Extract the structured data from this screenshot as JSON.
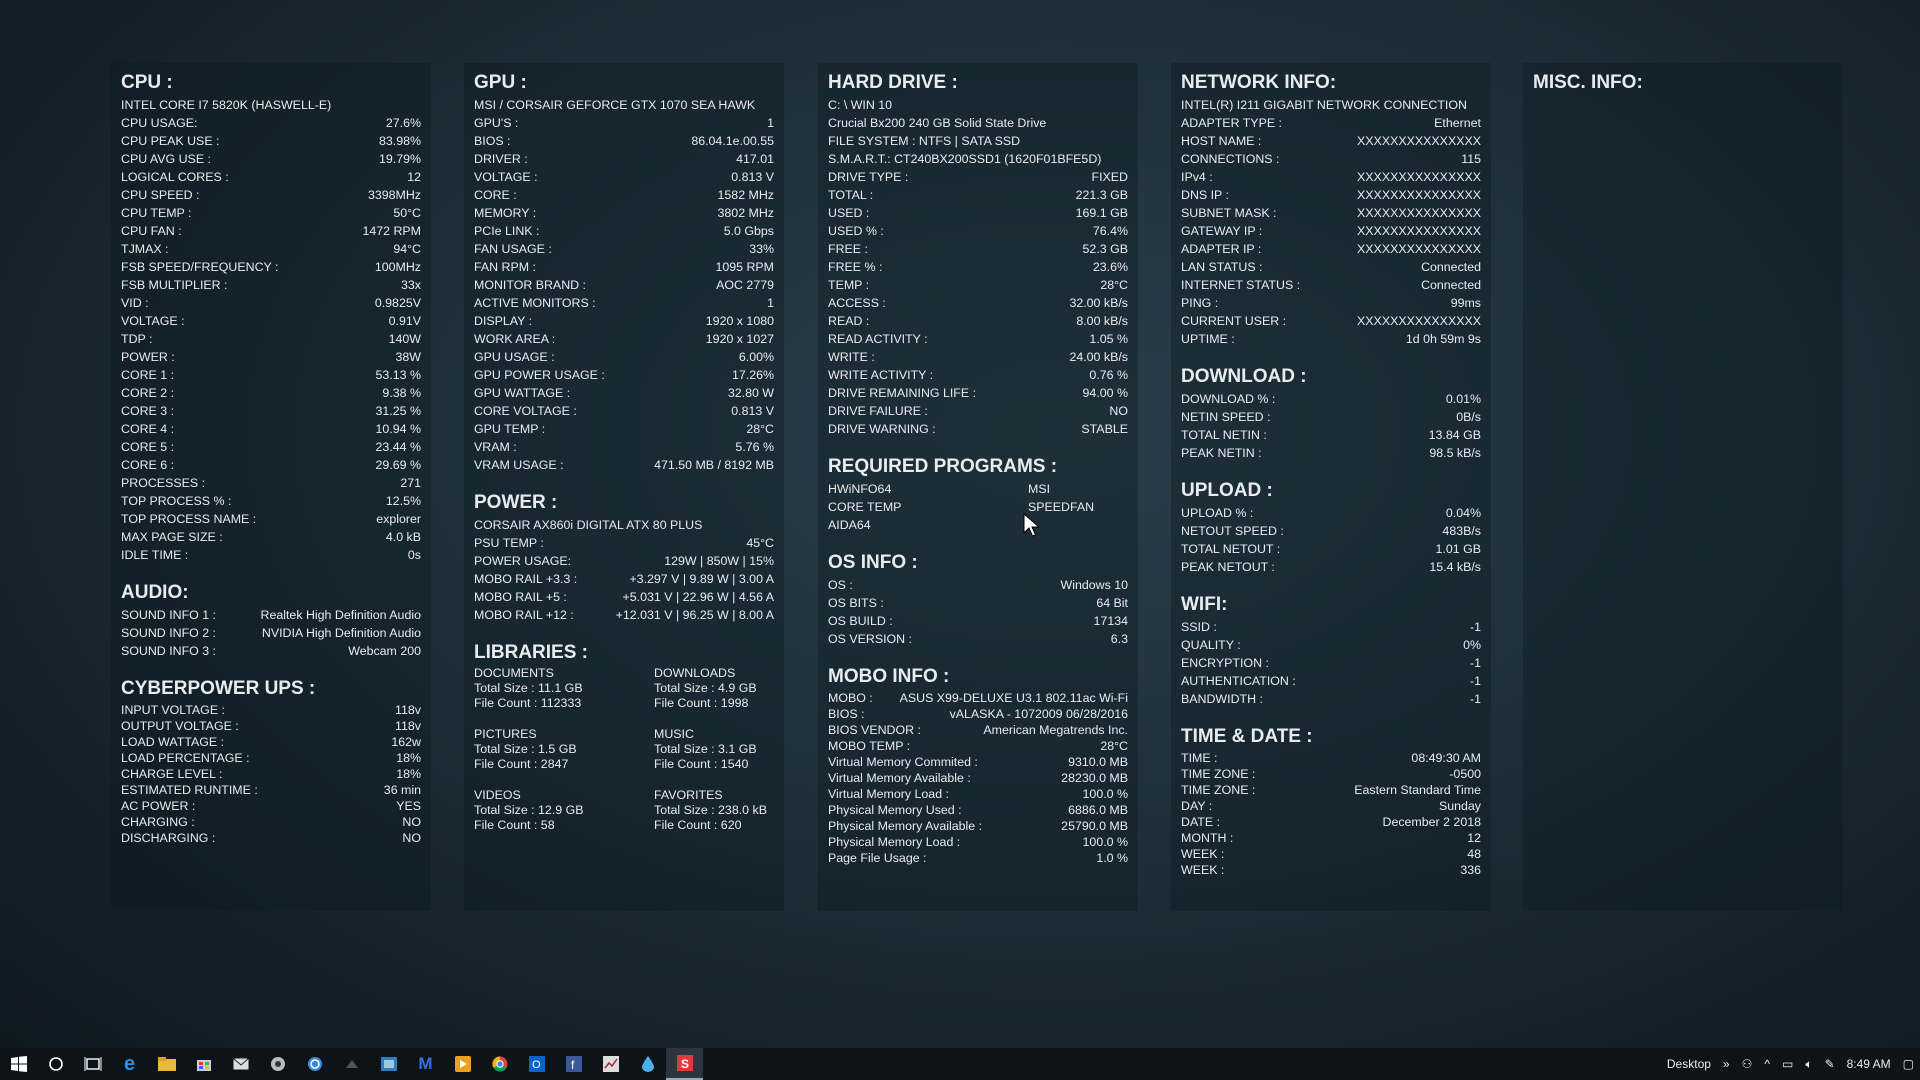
{
  "cpu": {
    "title": "CPU :",
    "model": "INTEL CORE I7 5820K (HASWELL-E)",
    "rows": [
      [
        "CPU USAGE:",
        "27.6%"
      ],
      [
        "CPU PEAK USE :",
        "83.98%"
      ],
      [
        "CPU AVG USE :",
        "19.79%"
      ],
      [
        "LOGICAL CORES :",
        "12"
      ],
      [
        "CPU SPEED :",
        "3398MHz"
      ],
      [
        "CPU TEMP :",
        "50°C"
      ],
      [
        "CPU FAN :",
        "1472 RPM"
      ],
      [
        "TJMAX :",
        "94°C"
      ],
      [
        "FSB SPEED/FREQUENCY :",
        "100MHz"
      ],
      [
        "FSB MULTIPLIER :",
        "33x"
      ],
      [
        "VID :",
        "0.9825V"
      ],
      [
        "VOLTAGE :",
        "0.91V"
      ],
      [
        "TDP :",
        "140W"
      ],
      [
        "POWER :",
        "38W"
      ],
      [
        "CORE 1 :",
        "53.13 %"
      ],
      [
        "CORE 2 :",
        "9.38 %"
      ],
      [
        "CORE 3 :",
        "31.25 %"
      ],
      [
        "CORE 4 :",
        "10.94 %"
      ],
      [
        "CORE 5 :",
        "23.44 %"
      ],
      [
        "CORE 6 :",
        "29.69 %"
      ],
      [
        "PROCESSES :",
        "271"
      ],
      [
        "TOP PROCESS % :",
        "12.5%"
      ],
      [
        "TOP PROCESS NAME :",
        "explorer"
      ],
      [
        "MAX PAGE SIZE :",
        "4.0 kB"
      ],
      [
        "IDLE TIME :",
        "0s"
      ]
    ]
  },
  "audio": {
    "title": "AUDIO:",
    "rows": [
      [
        "SOUND INFO 1 :",
        "Realtek High Definition Audio"
      ],
      [
        "SOUND INFO 2 :",
        "NVIDIA High Definition Audio"
      ],
      [
        "SOUND INFO 3 :",
        "Webcam 200"
      ]
    ]
  },
  "ups": {
    "title": "CYBERPOWER UPS :",
    "rows": [
      [
        "INPUT VOLTAGE :",
        "118v"
      ],
      [
        "OUTPUT VOLTAGE :",
        "118v"
      ],
      [
        "LOAD WATTAGE :",
        "162w"
      ],
      [
        "LOAD PERCENTAGE :",
        "18%"
      ],
      [
        "CHARGE LEVEL :",
        "18%"
      ],
      [
        "ESTIMATED RUNTIME :",
        "36 min"
      ],
      [
        "AC POWER :",
        "YES"
      ],
      [
        "CHARGING :",
        "NO"
      ],
      [
        "DISCHARGING :",
        "NO"
      ]
    ]
  },
  "gpu": {
    "title": "GPU :",
    "model": "MSI / CORSAIR  GEFORCE GTX 1070 SEA HAWK",
    "rows": [
      [
        "GPU'S :",
        "1"
      ],
      [
        "BIOS :",
        "86.04.1e.00.55"
      ],
      [
        "DRIVER :",
        "417.01"
      ],
      [
        "VOLTAGE :",
        "0.813 V"
      ],
      [
        "CORE :",
        "1582 MHz"
      ],
      [
        "MEMORY :",
        "3802 MHz"
      ],
      [
        "PCIe LINK :",
        "5.0 Gbps"
      ],
      [
        "FAN USAGE :",
        "33%"
      ],
      [
        "FAN RPM :",
        "1095 RPM"
      ],
      [
        "MONITOR BRAND :",
        "AOC 2779"
      ],
      [
        "ACTIVE MONITORS :",
        "1"
      ],
      [
        "DISPLAY :",
        "1920 x 1080"
      ],
      [
        "WORK AREA :",
        "1920 x 1027"
      ],
      [
        "GPU USAGE :",
        "6.00%"
      ],
      [
        "GPU POWER USAGE :",
        "17.26%"
      ],
      [
        "GPU WATTAGE :",
        "32.80 W"
      ],
      [
        "CORE VOLTAGE :",
        "0.813 V"
      ],
      [
        "GPU TEMP :",
        "28°C"
      ],
      [
        "VRAM :",
        "5.76 %"
      ],
      [
        "VRAM USAGE :",
        "471.50  MB / 8192 MB"
      ]
    ]
  },
  "power": {
    "title": "POWER :",
    "model": "CORSAIR AX860i DIGITAL ATX 80 PLUS",
    "rows": [
      [
        "PSU TEMP :",
        "45°C"
      ],
      [
        "POWER USAGE:",
        "129W  |  850W  |   15%"
      ],
      [
        "MOBO RAIL +3.3 :",
        "+3.297 V  |  9.89 W  |  3.00 A"
      ],
      [
        "MOBO RAIL +5 :",
        "+5.031 V  |  22.96 W  |  4.56 A"
      ],
      [
        "MOBO RAIL +12 :",
        "+12.031 V  |  96.25 W  |  8.00 A"
      ]
    ]
  },
  "libraries": {
    "title": "LIBRARIES :",
    "items": [
      {
        "name": "DOCUMENTS",
        "size": "Total Size : 11.1 GB",
        "count": "File Count : 112333"
      },
      {
        "name": "DOWNLOADS",
        "size": "Total Size : 4.9 GB",
        "count": "File Count : 1998"
      },
      {
        "name": "PICTURES",
        "size": "Total Size : 1.5 GB",
        "count": "File Count : 2847"
      },
      {
        "name": "MUSIC",
        "size": "Total Size : 3.1 GB",
        "count": "File Count : 1540"
      },
      {
        "name": "VIDEOS",
        "size": "Total Size : 12.9 GB",
        "count": "File Count : 58"
      },
      {
        "name": "FAVORITES",
        "size": "Total Size : 238.0 kB",
        "count": "File Count : 620"
      }
    ]
  },
  "hdd": {
    "title": "HARD DRIVE :",
    "lines": [
      "C: \\ WIN 10",
      "Crucial Bx200 240 GB Solid State Drive",
      "FILE SYSTEM : NTFS | SATA SSD",
      "S.M.A.R.T.: CT240BX200SSD1 (1620F01BFE5D)"
    ],
    "rows": [
      [
        "DRIVE TYPE :",
        "FIXED"
      ],
      [
        "TOTAL :",
        "221.3 GB"
      ],
      [
        "USED :",
        "169.1 GB"
      ],
      [
        "USED % :",
        "76.4%"
      ],
      [
        "FREE :",
        "52.3 GB"
      ],
      [
        "FREE % :",
        "23.6%"
      ],
      [
        "TEMP :",
        "28°C"
      ],
      [
        "ACCESS :",
        "32.00 kB/s"
      ],
      [
        "READ :",
        "8.00 kB/s"
      ],
      [
        "READ ACTIVITY :",
        "1.05 %"
      ],
      [
        "WRITE :",
        "24.00 kB/s"
      ],
      [
        "WRITE ACTIVITY :",
        "0.76 %"
      ],
      [
        "DRIVE REMAINING LIFE :",
        "94.00 %"
      ],
      [
        "DRIVE FAILURE :",
        "NO"
      ],
      [
        "DRIVE WARNING :",
        "STABLE"
      ]
    ]
  },
  "required": {
    "title": "REQUIRED PROGRAMS :",
    "items": [
      "HWiNFO64",
      "MSI",
      "CORE TEMP",
      "SPEEDFAN",
      "AIDA64",
      ""
    ]
  },
  "os": {
    "title": "OS INFO :",
    "rows": [
      [
        "OS :",
        "Windows 10"
      ],
      [
        "OS BITS :",
        "64 Bit"
      ],
      [
        "OS BUILD :",
        "17134"
      ],
      [
        "OS VERSION :",
        "6.3"
      ]
    ]
  },
  "mobo": {
    "title": "MOBO INFO :",
    "rows": [
      [
        "MOBO :",
        "ASUS X99-DELUXE U3.1 802.11ac Wi-Fi"
      ],
      [
        "BIOS :",
        "vALASKA - 1072009  06/28/2016"
      ],
      [
        "BIOS VENDOR :",
        "American Megatrends Inc."
      ],
      [
        "MOBO TEMP :",
        "28°C"
      ],
      [
        "Virtual Memory Commited :",
        "9310.0 MB"
      ],
      [
        "Virtual Memory  Available :",
        "28230.0 MB"
      ],
      [
        "Virtual Memory Load :",
        "100.0 %"
      ],
      [
        "Physical Memory Used :",
        "6886.0 MB"
      ],
      [
        "Physical Memory Available :",
        "25790.0 MB"
      ],
      [
        "Physical Memory Load :",
        "100.0 %"
      ],
      [
        "Page File Usage :",
        "1.0 %"
      ]
    ]
  },
  "network": {
    "title": "NETWORK INFO:",
    "model": "INTEL(R) I211 GIGABIT NETWORK CONNECTION",
    "rows": [
      [
        "ADAPTER TYPE :",
        "Ethernet"
      ],
      [
        "HOST NAME :",
        "XXXXXXXXXXXXXXX"
      ],
      [
        "CONNECTIONS :",
        "115"
      ],
      [
        "IPv4 :",
        "XXXXXXXXXXXXXXX"
      ],
      [
        "DNS IP :",
        "XXXXXXXXXXXXXXX"
      ],
      [
        "SUBNET MASK :",
        "XXXXXXXXXXXXXXX"
      ],
      [
        "GATEWAY IP :",
        "XXXXXXXXXXXXXXX"
      ],
      [
        "ADAPTER IP :",
        "XXXXXXXXXXXXXXX"
      ],
      [
        "LAN STATUS :",
        "Connected"
      ],
      [
        "INTERNET STATUS :",
        "Connected"
      ],
      [
        "PING :",
        "99ms"
      ],
      [
        "CURRENT USER :",
        "XXXXXXXXXXXXXXX"
      ],
      [
        "UPTIME :",
        "1d 0h 59m 9s"
      ]
    ]
  },
  "download": {
    "title": "DOWNLOAD :",
    "rows": [
      [
        "DOWNLOAD % :",
        "0.01%"
      ],
      [
        "NETIN SPEED :",
        "0B/s"
      ],
      [
        "TOTAL NETIN :",
        "13.84 GB"
      ],
      [
        "PEAK NETIN :",
        "98.5 kB/s"
      ]
    ]
  },
  "upload": {
    "title": "UPLOAD :",
    "rows": [
      [
        "UPLOAD % :",
        "0.04%"
      ],
      [
        "NETOUT SPEED :",
        "483B/s"
      ],
      [
        "TOTAL NETOUT :",
        "1.01 GB"
      ],
      [
        "PEAK NETOUT :",
        "15.4 kB/s"
      ]
    ]
  },
  "wifi": {
    "title": "WIFI:",
    "rows": [
      [
        "SSID :",
        "-1"
      ],
      [
        "QUALITY :",
        "0%"
      ],
      [
        "ENCRYPTION :",
        "-1"
      ],
      [
        "AUTHENTICATION :",
        "-1"
      ],
      [
        "BANDWIDTH :",
        "-1"
      ]
    ]
  },
  "time": {
    "title": "TIME & DATE :",
    "rows": [
      [
        "TIME :",
        "08:49:30   AM"
      ],
      [
        "TIME ZONE :",
        "-0500"
      ],
      [
        "TIME ZONE :",
        "Eastern Standard Time"
      ],
      [
        "DAY :",
        "Sunday"
      ],
      [
        "DATE :",
        "December  2 2018"
      ],
      [
        "MONTH :",
        "12"
      ],
      [
        "WEEK :",
        "48"
      ],
      [
        "WEEK :",
        "336"
      ]
    ]
  },
  "misc": {
    "title": "MISC. INFO:"
  },
  "taskbar": {
    "icons": [
      "windows-start",
      "search",
      "task-view",
      "edge",
      "file-explorer",
      "store",
      "mail",
      "app",
      "app",
      "app",
      "app",
      "app",
      "app",
      "app",
      "chrome",
      "outlook",
      "app",
      "app",
      "app",
      "app-active"
    ],
    "desktop_label": "Desktop",
    "clock": "8:49 AM"
  }
}
